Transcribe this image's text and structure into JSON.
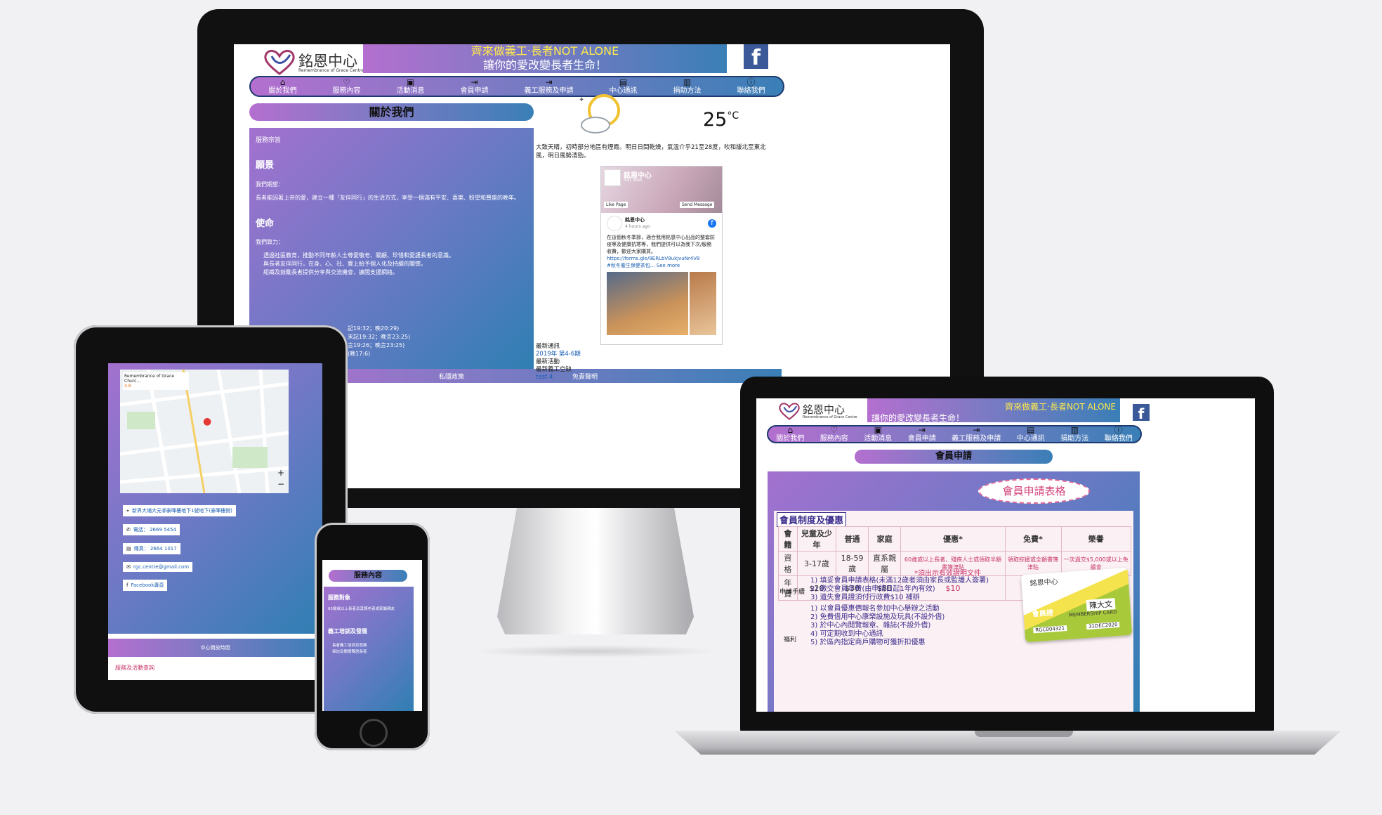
{
  "desktop": {
    "logo": {
      "name_zh": "銘恩中心",
      "name_en": "Remembrance of Grace Centre"
    },
    "banner": {
      "line1": "齊來做義工‧長者NOT ALONE",
      "line2": "讓你的愛改變長者生命！"
    },
    "facebook_icon": "f",
    "nav": [
      {
        "label": "關於我們",
        "icon": "home-icon",
        "glyph": "⌂"
      },
      {
        "label": "服務內容",
        "icon": "heart-icon",
        "glyph": "♡"
      },
      {
        "label": "活動消息",
        "icon": "calendar-icon",
        "glyph": "▣"
      },
      {
        "label": "會員申請",
        "icon": "login-icon",
        "glyph": "⇥"
      },
      {
        "label": "義工服務及申請",
        "icon": "login-icon",
        "glyph": "⇥"
      },
      {
        "label": "中心通訊",
        "icon": "document-icon",
        "glyph": "▤"
      },
      {
        "label": "捐助方法",
        "icon": "briefcase-icon",
        "glyph": "▥"
      },
      {
        "label": "聯絡我們",
        "icon": "info-icon",
        "glyph": "ⓘ"
      }
    ],
    "section_title": "關於我們",
    "img_alt": "服務宗旨",
    "vision_heading": "願景",
    "vision_lead": "我們期望：",
    "vision_text": "長者能因著上帝的愛，建立一種「友伴同行」的生活方式，享受一個滿有平安、喜樂、盼望和豐盛的晚年。",
    "mission_heading": "使命",
    "mission_lead": "我們致力：",
    "mission_items": [
      "透過社區教育，推動不同年齡人士尊愛敬老、關顧、珍惜和愛護長者的意識。",
      "與長者友伴同行，在身、心、社、靈上給予個人化及持續的關懷。",
      "組織及鼓勵長者提供分享與交流機會，擴闊支援網絡。"
    ],
    "hours_fragments": [
      "記19:32；晚20:29)",
      "末記19:32；晚言23:25)",
      "言19:26；晚言23:25)",
      "(晚17:6)"
    ],
    "weather": {
      "temperature": "25",
      "unit": "°C",
      "icon": "sun-cloud-icon",
      "forecast": "大致天晴，初時部分地區有煙霞。明日日間乾燥，氣溫介乎21至28度，吹和緩北至東北風，明日風勢清勁。"
    },
    "fb_widget": {
      "page_name": "銘恩中心",
      "likes": "341 likes",
      "like_btn": "Like Page",
      "msg_btn": "Send Message",
      "post_author": "銘恩中心",
      "post_time": "4 hours ago",
      "post_text": "在這個秋冬季節，適合我用銘恩中心出品的整套防疫等及健康抗寒等，我們提供可以為我下次/服務收費，歡迎大家購買。",
      "post_link": "https://forms.gle/9ERLbV8ukjvuNr4V8",
      "post_tags": "#秋冬養生保健茶包..."
    },
    "see_more": "See more",
    "news": [
      {
        "label": "最新通訊"
      },
      {
        "label": "2019年 第4-6期",
        "link": true
      },
      {
        "label": "最新活動"
      },
      {
        "label": "最新義工空缺"
      },
      {
        "label": "test 4",
        "link": true
      }
    ],
    "footer_items": [
      "私隱政策",
      "免責聲明"
    ]
  },
  "tablet": {
    "map_title": "Remembrance of Grace Churc...",
    "map_rating": "4.8",
    "contacts": [
      {
        "icon": "location-pin-icon",
        "glyph": "⌖",
        "text": "新界大埔大元邨泰暉樓地下1號地下(泰暉樓側)"
      },
      {
        "icon": "phone-icon",
        "glyph": "✆",
        "text": "電話： 2669 5454"
      },
      {
        "icon": "fax-icon",
        "glyph": "▤",
        "text": "傳真： 2664 1017"
      },
      {
        "icon": "envelope-icon",
        "glyph": "✉",
        "text": "rgc.centre@gmail.com"
      },
      {
        "icon": "facebook-icon",
        "glyph": "f",
        "text": "Facebook專頁"
      }
    ],
    "footer_img_alt": "中心開放時間",
    "bottom_strip": "服務及活動查詢"
  },
  "phone": {
    "section_title": "服務內容",
    "h1": "服務對象",
    "p1": "65歲或以上長者及其護老者或家屬親友",
    "h2": "義工培訓及發展",
    "bullets": [
      "長者義工培訓及發展",
      "探訪及關懷獨居長者"
    ]
  },
  "laptop": {
    "banner": {
      "line1": "齊來做義工‧長者NOT ALONE",
      "line2": "讓你的愛改變長者生命！"
    },
    "section_title": "會員申請",
    "form_title": "會員申請表格",
    "table_title": "會員制度及優惠",
    "header_row": [
      "會籍",
      "兒童及少年",
      "普通",
      "家庭",
      "優惠*",
      "免費*",
      "榮譽"
    ],
    "age_row": [
      "資格",
      "3-17歲",
      "18-59歲",
      "直系親屬",
      "60歲或以上長者、殘疾人士或領取半額書簿津貼",
      "領取綜援或全額書簿津貼",
      "一次過交$5,000或以上免續會"
    ],
    "fee_row": [
      "年費",
      "$20",
      "$30",
      "$80",
      "$10",
      "免費"
    ],
    "proof_note": "*須出示有效證明文件",
    "procedure_label": "申請手續",
    "procedures": [
      "1) 填妥會員申請表格(未滿12歲者須由家長或監護人簽署)",
      "2) 繳交會員年費(由申請日起1年內有效)",
      "3) 遺失會員證須付行政費$10 補辦"
    ],
    "benefits_label": "福利",
    "benefits": [
      "1) 以會員優惠價報名參加中心舉辦之活動",
      "2) 免費借用中心康樂設施及玩具(不設外借)",
      "3) 於中心內閱覽報章、雜誌(不設外借)",
      "4) 可定期收到中心通訊",
      "5) 於區內指定商戶購物可獲折扣優惠"
    ],
    "card": {
      "name": "陳大文",
      "card_zh": "會員證",
      "card_en": "MEMBERSHIP CARD",
      "number": "RGC004321",
      "expiry": "31DEC2020",
      "logo": "銘恩中心"
    }
  },
  "colors": {
    "gradient_start": "#b46fcf",
    "gradient_end": "#3a7fb7",
    "nav_border": "#1e3a6e",
    "facebook_blue": "#3b5998",
    "link_blue": "#1a5fb4"
  }
}
